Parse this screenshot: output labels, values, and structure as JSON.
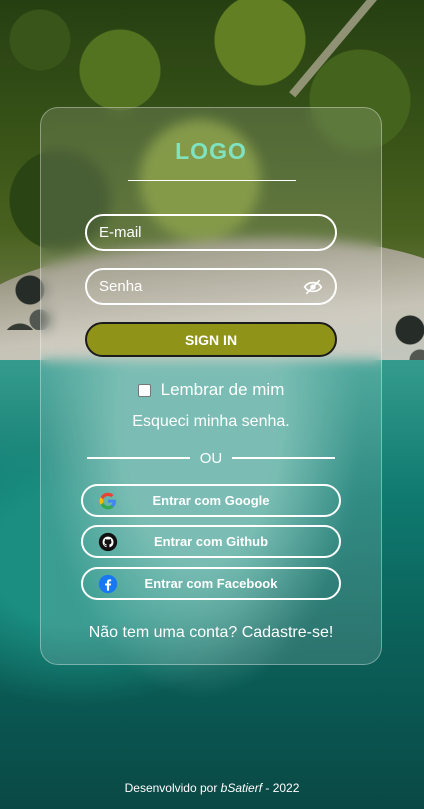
{
  "logo": {
    "text": "LOGO",
    "color": "#7fe3c1"
  },
  "form": {
    "email_placeholder": "E-mail",
    "password_placeholder": "Senha",
    "password_toggle_icon": "eye-off-icon",
    "signin_label": "SIGN IN",
    "signin_color": "#8f9419",
    "remember_label": "Lembrar de mim",
    "remember_checked": false,
    "forgot_label": "Esqueci minha senha."
  },
  "divider": {
    "label": "OU"
  },
  "social": [
    {
      "label": "Entrar com Google",
      "icon": "google-icon"
    },
    {
      "label": "Entrar com Github",
      "icon": "github-icon"
    },
    {
      "label": "Entrar com Facebook",
      "icon": "facebook-icon"
    }
  ],
  "signup": {
    "label": "Não tem uma conta? Cadastre-se!"
  },
  "footer": {
    "prefix": "Desenvolvido por ",
    "author": "bSatierf",
    "suffix": " - 2022"
  }
}
